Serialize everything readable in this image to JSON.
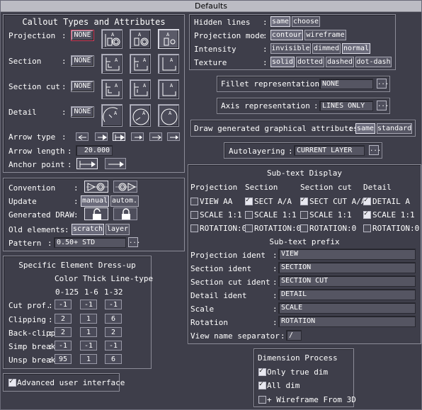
{
  "window": {
    "title": "Defaults"
  },
  "callout": {
    "title": "Callout Types and Attributes",
    "projection_label": "Projection",
    "projection_none": "NONE",
    "section_label": "Section",
    "section_none": "NONE",
    "section_cut_label": "Section cut",
    "section_cut_none": "NONE",
    "detail_label": "Detail",
    "detail_none": "NONE",
    "colon": ":",
    "arrow_type_label": "Arrow type",
    "arrow_length_label": "Arrow length",
    "arrow_length_value": "20.000",
    "anchor_point_label": "Anchor point"
  },
  "convention": {
    "convention_label": "Convention",
    "update_label": "Update",
    "update_manual": "manual",
    "update_autom": "autom.",
    "generated_draw_label": "Generated DRAW",
    "old_elements_label": "Old elements",
    "old_scratch": "scratch",
    "old_layer": "layer",
    "pattern_label": "Pattern",
    "pattern_value": "0.50+   STD",
    "more": "..."
  },
  "dressup": {
    "title": "Specific Element Dress-up",
    "col_header": "Color Thick Line-type",
    "col_ranges": [
      "0-125",
      "1-6",
      "1-32"
    ],
    "rows": [
      {
        "label": "Cut prof.",
        "values": [
          "-1",
          "-1",
          "-1"
        ]
      },
      {
        "label": "Clipping",
        "values": [
          "2",
          "1",
          "6"
        ]
      },
      {
        "label": "Back-clipp",
        "values": [
          "2",
          "1",
          "2"
        ]
      },
      {
        "label": "Simp break",
        "values": [
          "-1",
          "-1",
          "-1"
        ]
      },
      {
        "label": "Unsp break",
        "values": [
          "95",
          "1",
          "6"
        ]
      }
    ]
  },
  "advanced": {
    "label": "Advanced user interface",
    "checked": true
  },
  "display": {
    "hidden_lines_label": "Hidden lines",
    "hidden_same": "same",
    "hidden_choose": "choose",
    "projection_mode_label": "Projection mode",
    "pm_contour": "contour",
    "pm_wireframe": "wireframe",
    "intensity_label": "Intensity",
    "int_invisible": "invisible",
    "int_dimmed": "dimmed",
    "int_normal": "normal",
    "texture_label": "Texture",
    "tex_solid": "solid",
    "tex_dotted": "dotted",
    "tex_dashed": "dashed",
    "tex_dotdash": "dot-dash"
  },
  "fillet": {
    "label": "Fillet representation",
    "value": "NONE"
  },
  "axis": {
    "label": "Axis representation",
    "value": "LINES ONLY"
  },
  "generated": {
    "label": "Draw generated graphical attributes",
    "same": "same",
    "standard": "standard"
  },
  "autolayering": {
    "label": "Autolayering",
    "value": "CURRENT LAYER"
  },
  "subtext": {
    "title": "Sub-text Display",
    "headers": [
      "Projection",
      "Section",
      "Section cut",
      "Detail"
    ],
    "rows": [
      {
        "cells": [
          {
            "label": "VIEW AA",
            "checked": false
          },
          {
            "label": "SECT A/A",
            "checked": true
          },
          {
            "label": "SECT CUT A/A",
            "checked": true
          },
          {
            "label": "DETAIL A",
            "checked": true
          }
        ]
      },
      {
        "cells": [
          {
            "label": "SCALE 1:1",
            "checked": false
          },
          {
            "label": "SCALE 1:1",
            "checked": false
          },
          {
            "label": "SCALE 1:1",
            "checked": false
          },
          {
            "label": "SCALE  1:1",
            "checked": true
          }
        ]
      },
      {
        "cells": [
          {
            "label": "ROTATION:0",
            "checked": false
          },
          {
            "label": "ROTATION:0",
            "checked": false
          },
          {
            "label": "ROTATION:0",
            "checked": false
          },
          {
            "label": "ROTATION:0",
            "checked": false
          }
        ]
      }
    ],
    "prefix_title": "Sub-text prefix",
    "prefixes": [
      {
        "label": "Projection ident",
        "value": "VIEW"
      },
      {
        "label": "Section ident",
        "value": "SECTION"
      },
      {
        "label": "Section cut ident",
        "value": "SECTION CUT"
      },
      {
        "label": "Detail ident",
        "value": "DETAIL"
      },
      {
        "label": "Scale",
        "value": "SCALE"
      },
      {
        "label": "Rotation",
        "value": "ROTATION"
      }
    ],
    "separator_label": "View name separator",
    "separator_value": "/"
  },
  "dimension": {
    "title": "Dimension Process",
    "items": [
      {
        "label": "Only true dim",
        "checked": true
      },
      {
        "label": "All dim",
        "checked": true
      },
      {
        "label": "+ Wireframe From 3D",
        "checked": false
      }
    ]
  }
}
